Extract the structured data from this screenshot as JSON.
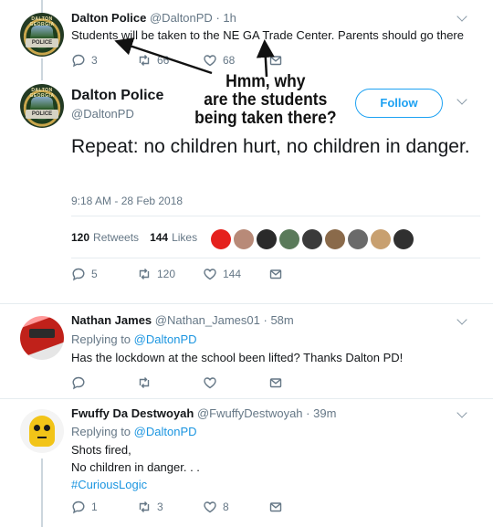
{
  "quoted_tweet": {
    "name": "Dalton Police",
    "handle": "@DaltonPD",
    "time": "· 1h",
    "text": "Students will be taken to the NE GA Trade Center. Parents should go there",
    "reply_count": "3",
    "retweet_count": "66",
    "like_count": "68"
  },
  "main_tweet": {
    "name": "Dalton Police",
    "handle": "@DaltonPD",
    "follow_label": "Follow",
    "text": "Repeat: no children hurt, no children in danger.",
    "timestamp": "9:18 AM - 28 Feb 2018",
    "retweets_count": "120",
    "retweets_label": "Retweets",
    "likes_count": "144",
    "likes_label": "Likes",
    "reply_count": "5",
    "retweet_count": "120",
    "like_count": "144",
    "likers": [
      "#e5211d",
      "#b88a78",
      "#2a2a2a",
      "#5a7a5a",
      "#3a3a3a",
      "#8a6a4a",
      "#6a6a6a",
      "#c8a070",
      "#303030"
    ]
  },
  "replies": [
    {
      "name": "Nathan James",
      "handle": "@Nathan_James01",
      "time": "· 58m",
      "replying_prefix": "Replying to",
      "replying_to": "@DaltonPD",
      "text": "Has the lockdown at the school been lifted? Thanks Dalton PD!",
      "reply_count": "",
      "retweet_count": "",
      "like_count": ""
    },
    {
      "name": "Fwuffy Da Destwoyah",
      "handle": "@FwuffyDestwoyah",
      "time": "· 39m",
      "replying_prefix": "Replying to",
      "replying_to": "@DaltonPD",
      "text_line1": "Shots fired,",
      "text_line2": "No children in danger. . .",
      "hashtag": "#CuriousLogic",
      "reply_count": "1",
      "retweet_count": "3",
      "like_count": "8"
    }
  ],
  "annotation": {
    "line1": "Hmm, why",
    "line2": "are the students",
    "line3": "being taken there?"
  },
  "avatar_text": {
    "top": "DALTON GEORGIA",
    "plate": "POLICE"
  }
}
